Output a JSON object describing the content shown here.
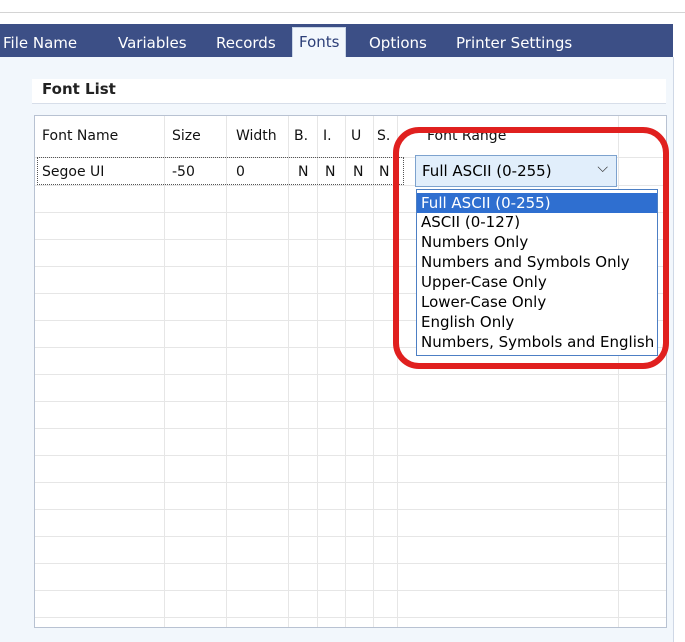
{
  "tabs": [
    {
      "label": "File Name"
    },
    {
      "label": "Variables"
    },
    {
      "label": "Records"
    },
    {
      "label": "Fonts",
      "active": true
    },
    {
      "label": "Options"
    },
    {
      "label": "Printer Settings"
    }
  ],
  "section": {
    "title": "Font List"
  },
  "grid": {
    "columns": [
      "Font Name",
      "Size",
      "Width",
      "B.",
      "I.",
      "U",
      "S.",
      "Font Range"
    ],
    "row": {
      "font_name": "Segoe UI",
      "size": "-50",
      "width": "0",
      "bold": "N",
      "italic": "N",
      "underline": "N",
      "strike": "N"
    }
  },
  "combo": {
    "value": "Full ASCII (0-255)",
    "icon": "chevron-down-icon"
  },
  "dropdown": {
    "options": [
      "Full ASCII (0-255)",
      "ASCII (0-127)",
      "Numbers Only",
      "Numbers and Symbols Only",
      "Upper-Case Only",
      "Lower-Case Only",
      "English Only",
      "Numbers, Symbols and English"
    ],
    "selected_index": 0
  },
  "colors": {
    "tab_bar": "#3c4f86",
    "panel": "#f2f7fc",
    "selection": "#2f6fd0",
    "highlight": "#e0201f"
  }
}
